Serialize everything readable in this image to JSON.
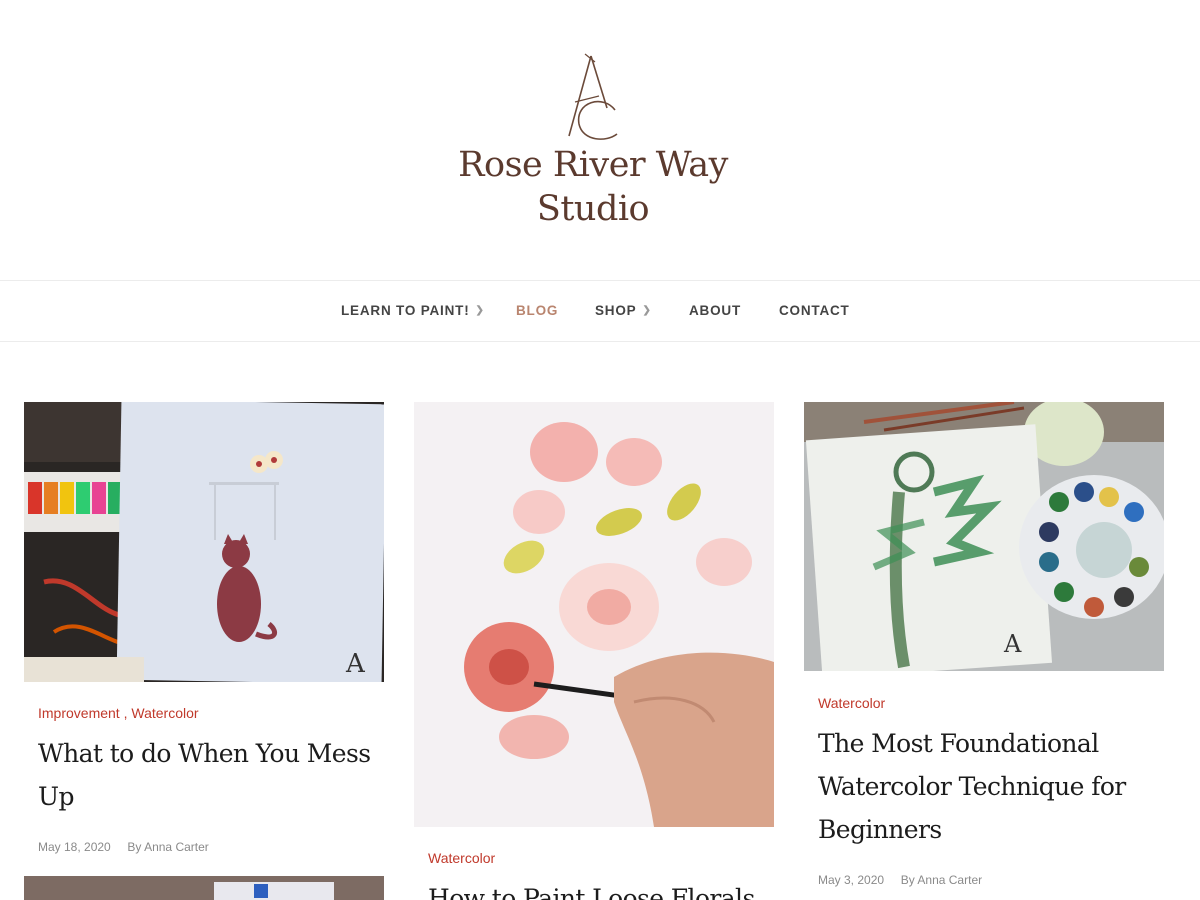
{
  "site": {
    "title_line1": "Rose River Way",
    "title_line2": "Studio",
    "logo": "AC monogram logo"
  },
  "nav": {
    "items": [
      {
        "label": "LEARN TO PAINT!",
        "has_dropdown": true
      },
      {
        "label": "BLOG",
        "active": true
      },
      {
        "label": "SHOP",
        "has_dropdown": true
      },
      {
        "label": "ABOUT"
      },
      {
        "label": "CONTACT"
      }
    ]
  },
  "posts": [
    {
      "categories": [
        "Improvement",
        "Watercolor"
      ],
      "category_sep": ",",
      "title": "What to do When You Mess Up",
      "date": "May 18, 2020",
      "author": "By Anna Carter"
    },
    {
      "categories": [
        "Watercolor"
      ],
      "title": "How to Paint Loose Florals"
    },
    {
      "categories": [
        "Watercolor"
      ],
      "title": "The Most Foundational Watercolor Technique for Beginners",
      "date": "May 3, 2020",
      "author": "By Anna Carter"
    }
  ],
  "colors": {
    "brand": "#5b3a2e",
    "accent": "#c0392b",
    "nav_active": "#b9856f"
  }
}
